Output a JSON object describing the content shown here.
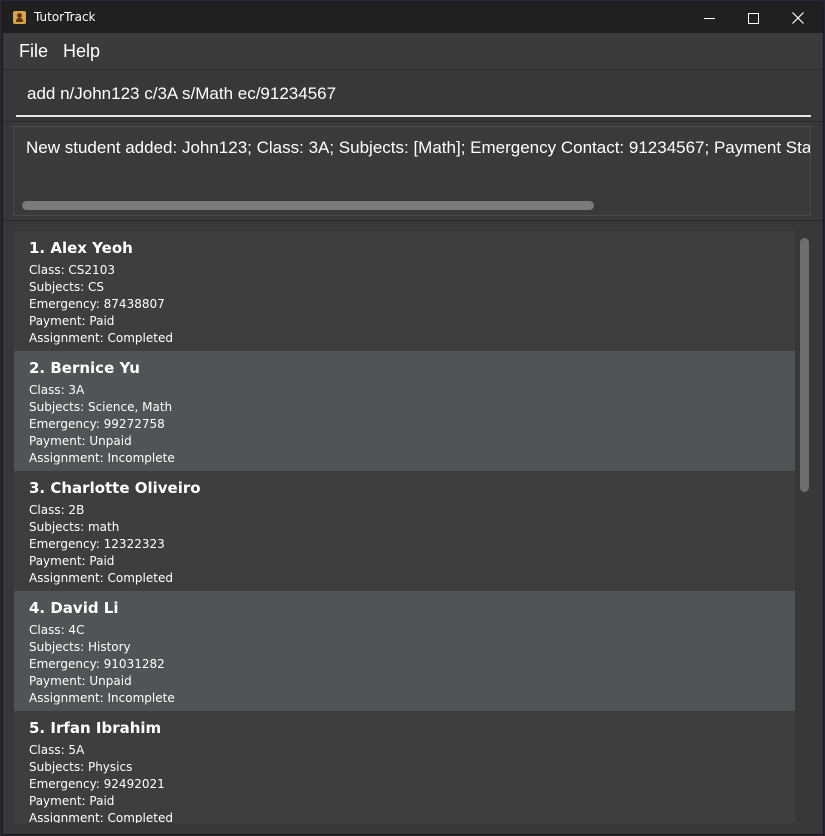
{
  "window": {
    "title": "TutorTrack"
  },
  "menu": {
    "file": "File",
    "help": "Help"
  },
  "command": {
    "value": "add n/John123 c/3A s/Math ec/91234567"
  },
  "result": {
    "text": "New student added: John123; Class: 3A; Subjects: [Math]; Emergency Contact: 91234567; Payment Status: Un"
  },
  "students": [
    {
      "name": "1. Alex Yeoh",
      "class": "Class: CS2103",
      "subjects": "Subjects: CS",
      "emergency": "Emergency: 87438807",
      "payment": "Payment: Paid",
      "assignment": "Assignment: Completed"
    },
    {
      "name": "2. Bernice Yu",
      "class": "Class: 3A",
      "subjects": "Subjects: Science, Math",
      "emergency": "Emergency: 99272758",
      "payment": "Payment: Unpaid",
      "assignment": "Assignment: Incomplete"
    },
    {
      "name": "3. Charlotte Oliveiro",
      "class": "Class: 2B",
      "subjects": "Subjects: math",
      "emergency": "Emergency: 12322323",
      "payment": "Payment: Paid",
      "assignment": "Assignment: Completed"
    },
    {
      "name": "4. David Li",
      "class": "Class: 4C",
      "subjects": "Subjects: History",
      "emergency": "Emergency: 91031282",
      "payment": "Payment: Unpaid",
      "assignment": "Assignment: Incomplete"
    },
    {
      "name": "5. Irfan Ibrahim",
      "class": "Class: 5A",
      "subjects": "Subjects: Physics",
      "emergency": "Emergency: 92492021",
      "payment": "Payment: Paid",
      "assignment": "Assignment: Completed"
    }
  ]
}
